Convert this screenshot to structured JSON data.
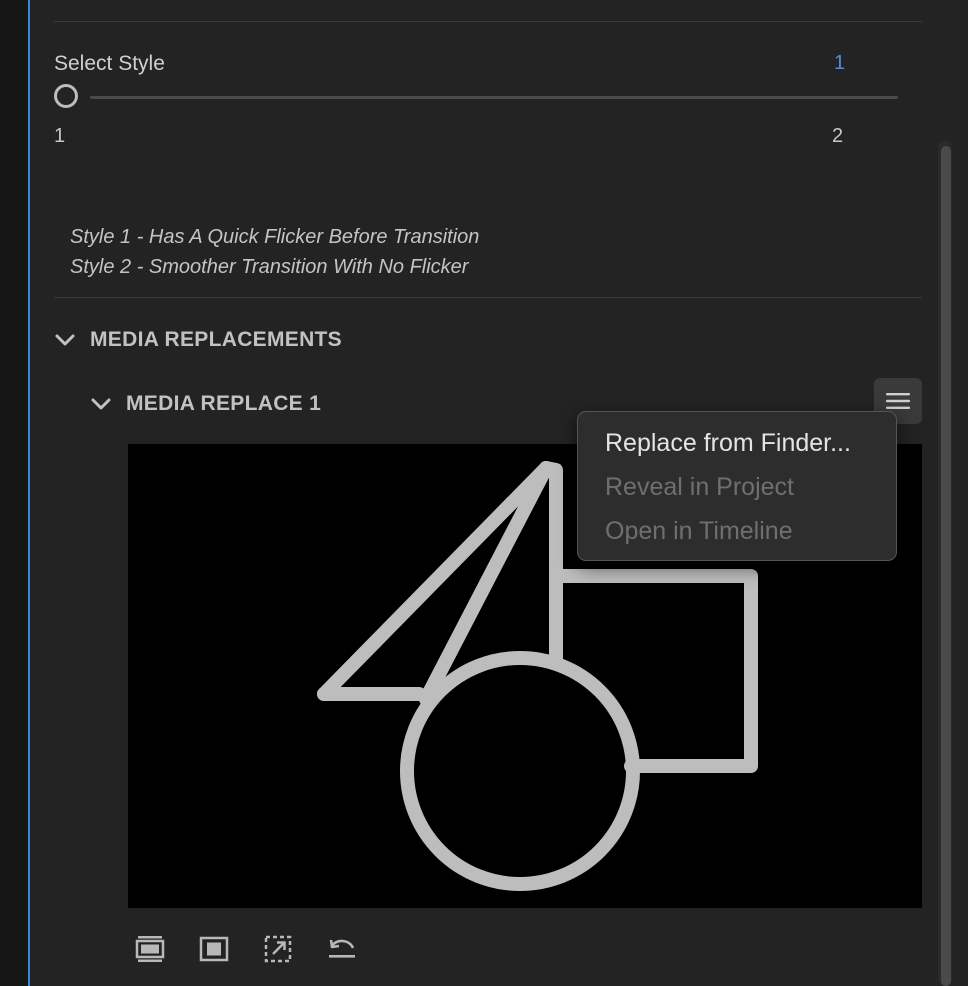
{
  "select_style": {
    "label": "Select Style",
    "value": "1",
    "min_label": "1",
    "max_label": "2",
    "slider_position": 0.0
  },
  "descriptions": [
    "Style 1 - Has A Quick Flicker Before Transition",
    "Style 2 - Smoother Transition With No Flicker"
  ],
  "media_replacements": {
    "title": "MEDIA REPLACEMENTS",
    "expanded": true
  },
  "media_replace_1": {
    "title": "MEDIA REPLACE 1",
    "expanded": true,
    "menu_icon": "hamburger-menu-icon"
  },
  "context_menu": {
    "items": [
      {
        "label": "Replace from Finder...",
        "enabled": true
      },
      {
        "label": "Reveal in Project",
        "enabled": false
      },
      {
        "label": "Open in Timeline",
        "enabled": false
      }
    ]
  },
  "preview": {
    "placeholder_icon": "shapes-placeholder-icon"
  },
  "toolbar": {
    "icons": [
      "fill-frame-icon",
      "fit-frame-icon",
      "scale-frame-icon",
      "undo-icon"
    ]
  },
  "colors": {
    "accent": "#4a90e2",
    "panel_bg": "#232323",
    "preview_bg": "#000000",
    "menu_bg": "#2d2d2d"
  }
}
